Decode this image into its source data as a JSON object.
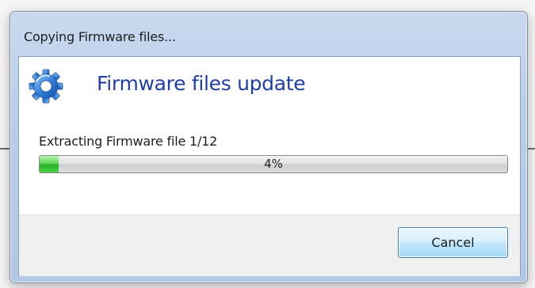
{
  "window": {
    "title": "Copying Firmware files..."
  },
  "header": {
    "title": "Firmware files update",
    "icon": "gear-icon"
  },
  "status": {
    "text": "Extracting Firmware file 1/12"
  },
  "progress": {
    "percent": 4,
    "label": "4%"
  },
  "buttons": {
    "cancel_label": "Cancel"
  },
  "colors": {
    "header_title": "#1f3fa8",
    "progress_fill": "#26b324",
    "gear": "#2f7bd6"
  }
}
